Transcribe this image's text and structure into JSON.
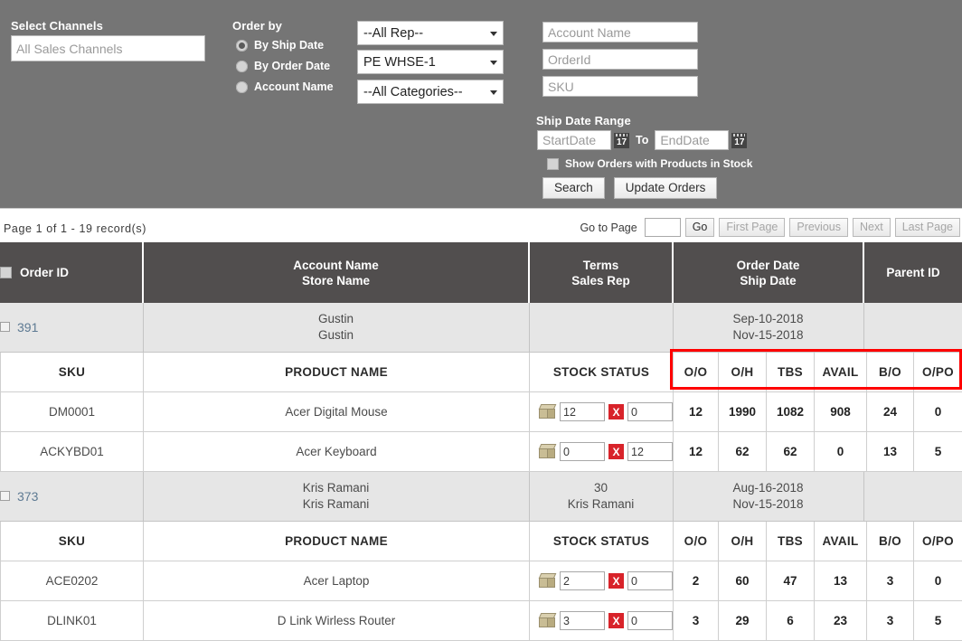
{
  "filters": {
    "select_channels": {
      "label": "Select Channels",
      "placeholder": "All Sales Channels",
      "value": ""
    },
    "order_by": {
      "label": "Order by",
      "options": [
        {
          "label": "By Ship Date",
          "checked": true
        },
        {
          "label": "By Order Date",
          "checked": false
        },
        {
          "label": "Account Name",
          "checked": false
        }
      ]
    },
    "selects": [
      {
        "name": "rep",
        "value": "--All Rep--"
      },
      {
        "name": "warehouse",
        "value": "PE WHSE-1"
      },
      {
        "name": "category",
        "value": "--All Categories--"
      }
    ],
    "text_fields": [
      {
        "name": "account-name",
        "placeholder": "Account Name",
        "value": ""
      },
      {
        "name": "order-id",
        "placeholder": "OrderId",
        "value": ""
      },
      {
        "name": "sku",
        "placeholder": "SKU",
        "value": ""
      }
    ],
    "ship_date_range": {
      "label": "Ship Date Range",
      "start_placeholder": "StartDate",
      "start_value": "",
      "to": "To",
      "end_placeholder": "EndDate",
      "end_value": "",
      "calendar_icon_text": "17"
    },
    "in_stock_checkbox": {
      "label": "Show Orders with Products in Stock",
      "checked": false
    },
    "buttons": {
      "search": "Search",
      "update_orders": "Update Orders"
    }
  },
  "pagination": {
    "info": "Page  1  of  1   -   19 record(s)",
    "goto_label": "Go to Page",
    "goto_value": "",
    "go": "Go",
    "first_page": "First Page",
    "previous": "Previous",
    "next": "Next",
    "last_page": "Last Page"
  },
  "grid": {
    "headers": [
      {
        "line1": "Order ID",
        "line2": ""
      },
      {
        "line1": "Account Name",
        "line2": "Store Name"
      },
      {
        "line1": "Terms",
        "line2": "Sales Rep"
      },
      {
        "line1": "Order Date",
        "line2": "Ship Date"
      },
      {
        "line1": "Parent ID",
        "line2": ""
      }
    ],
    "sub_headers": [
      "SKU",
      "PRODUCT NAME",
      "STOCK STATUS",
      "O/O",
      "O/H",
      "TBS",
      "AVAIL",
      "B/O",
      "O/PO"
    ],
    "orders": [
      {
        "order_id": "391",
        "account_name": "Gustin",
        "store_name": "Gustin",
        "terms": "",
        "sales_rep": "",
        "order_date": "Sep-10-2018",
        "ship_date": "Nov-15-2018",
        "parent_id": "",
        "products": [
          {
            "sku": "DM0001",
            "product_name": "Acer Digital Mouse",
            "qty_left": "12",
            "qty_right": "0",
            "oo": "12",
            "oh": "1990",
            "tbs": "1082",
            "avail": "908",
            "bo": "24",
            "opo": "0"
          },
          {
            "sku": "ACKYBD01",
            "product_name": "Acer Keyboard",
            "qty_left": "0",
            "qty_right": "12",
            "oo": "12",
            "oh": "62",
            "tbs": "62",
            "avail": "0",
            "bo": "13",
            "opo": "5"
          }
        ]
      },
      {
        "order_id": "373",
        "account_name": "Kris Ramani",
        "store_name": "Kris Ramani",
        "terms": "30",
        "sales_rep": "Kris Ramani",
        "order_date": "Aug-16-2018",
        "ship_date": "Nov-15-2018",
        "parent_id": "",
        "products": [
          {
            "sku": "ACE0202",
            "product_name": "Acer Laptop",
            "qty_left": "2",
            "qty_right": "0",
            "oo": "2",
            "oh": "60",
            "tbs": "47",
            "avail": "13",
            "bo": "3",
            "opo": "0"
          },
          {
            "sku": "DLINK01",
            "product_name": "D Link Wirless Router",
            "qty_left": "3",
            "qty_right": "0",
            "oo": "3",
            "oh": "29",
            "tbs": "6",
            "avail": "23",
            "bo": "3",
            "opo": "5"
          }
        ]
      }
    ],
    "remove_icon_label": "X"
  },
  "colors": {
    "panel_bg": "#757575",
    "header_row_bg": "#514e4e",
    "order_row_bg": "#e6e6e6",
    "highlight": "#ff0000",
    "remove_btn": "#d8232a",
    "link": "#5e7a93"
  }
}
